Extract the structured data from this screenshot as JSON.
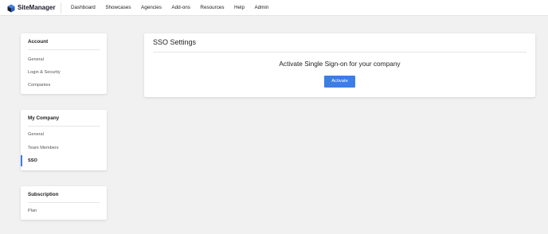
{
  "app": {
    "logo_text": "SiteManager",
    "logo_icon": "sitemanager-logo-icon"
  },
  "nav": {
    "items": [
      "Dashboard",
      "Showcases",
      "Agencies",
      "Add-ons",
      "Resources",
      "Help",
      "Admin"
    ]
  },
  "sidebar": {
    "account": {
      "title": "Account",
      "items": [
        "General",
        "Login & Security",
        "Companies"
      ]
    },
    "my_company": {
      "title": "My Company",
      "items": [
        "General",
        "Team Members",
        "SSO"
      ],
      "active_item": "SSO"
    },
    "subscription": {
      "title": "Subscription",
      "items": [
        "Plan"
      ]
    }
  },
  "main": {
    "title": "SSO Settings",
    "headline": "Activate Single Sign-on for your company",
    "activate_label": "Activate"
  },
  "colors": {
    "accent": "#3d7ee3",
    "background": "#f1f1f1",
    "card": "#ffffff",
    "logo_dark": "#1b1b2f"
  }
}
